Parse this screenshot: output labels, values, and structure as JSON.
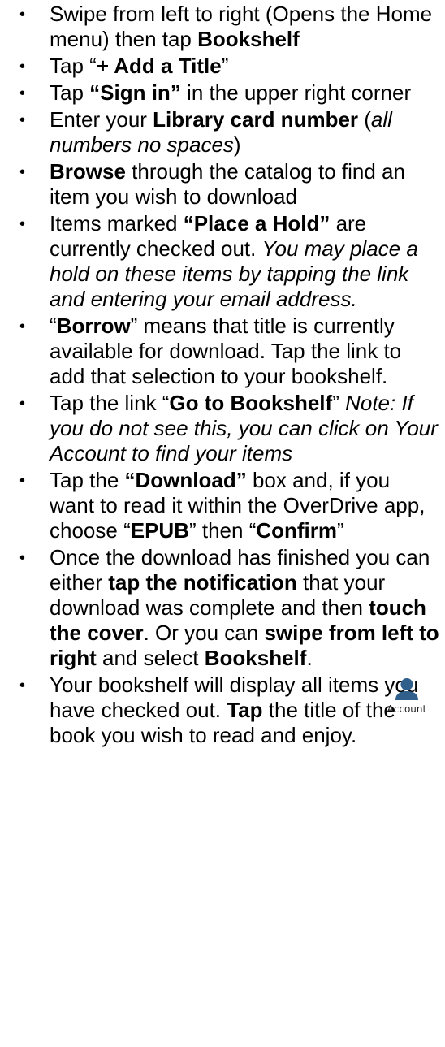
{
  "steps": [
    [
      {
        "t": "Swipe from left to right (Opens the Home menu) then tap "
      },
      {
        "t": "Bookshelf",
        "b": true
      }
    ],
    [
      {
        "t": "Tap “"
      },
      {
        "t": "+ Add a Title",
        "b": true
      },
      {
        "t": "”"
      }
    ],
    [
      {
        "t": "Tap "
      },
      {
        "t": "“Sign in”",
        "b": true
      },
      {
        "t": " in the upper right corner"
      }
    ],
    [
      {
        "t": "Enter your "
      },
      {
        "t": "Library card number",
        "b": true
      },
      {
        "t": " ("
      },
      {
        "t": "all numbers no spaces",
        "i": true
      },
      {
        "t": ")"
      }
    ],
    [
      {
        "t": "Browse",
        "b": true
      },
      {
        "t": " through the catalog to find an item you wish to download"
      }
    ],
    [
      {
        "t": "Items marked "
      },
      {
        "t": "“Place a Hold”",
        "b": true
      },
      {
        "t": " are currently checked out. "
      },
      {
        "t": "You may place a hold on these items by tapping the link and entering your email address.",
        "i": true
      }
    ],
    [
      {
        "t": "“"
      },
      {
        "t": "Borrow",
        "b": true
      },
      {
        "t": "”  means that title is currently available for download. Tap the link to add that selection to your bookshelf."
      }
    ],
    [
      {
        "t": "Tap the link “"
      },
      {
        "t": "Go to Bookshelf",
        "b": true
      },
      {
        "t": "” "
      },
      {
        "t": "Note: If you do not see this, you can click on Your Account to find your items",
        "i": true
      }
    ],
    [
      {
        "t": "Tap the "
      },
      {
        "t": "“Download”",
        "b": true
      },
      {
        "t": " box and, if you want to read it within the OverDrive app, choose “"
      },
      {
        "t": "EPUB",
        "b": true
      },
      {
        "t": "” then “"
      },
      {
        "t": "Confirm",
        "b": true
      },
      {
        "t": "”"
      }
    ],
    [
      {
        "t": "Once the download has finished you can either "
      },
      {
        "t": "tap the notification",
        "b": true
      },
      {
        "t": " that your download was  complete and then "
      },
      {
        "t": "touch the cover",
        "b": true
      },
      {
        "t": ". Or you can "
      },
      {
        "t": "swipe from left to right",
        "b": true
      },
      {
        "t": " and select "
      },
      {
        "t": "Bookshelf",
        "b": true
      },
      {
        "t": "."
      }
    ],
    [
      {
        "t": "Your bookshelf will display all items you have checked out. "
      },
      {
        "t": "Tap",
        "b": true
      },
      {
        "t": " the title of the book you wish to read and enjoy."
      }
    ]
  ],
  "bullet_char": "•",
  "account": {
    "label": "Account",
    "icon": "person-icon",
    "color": "#2f5f8a"
  }
}
